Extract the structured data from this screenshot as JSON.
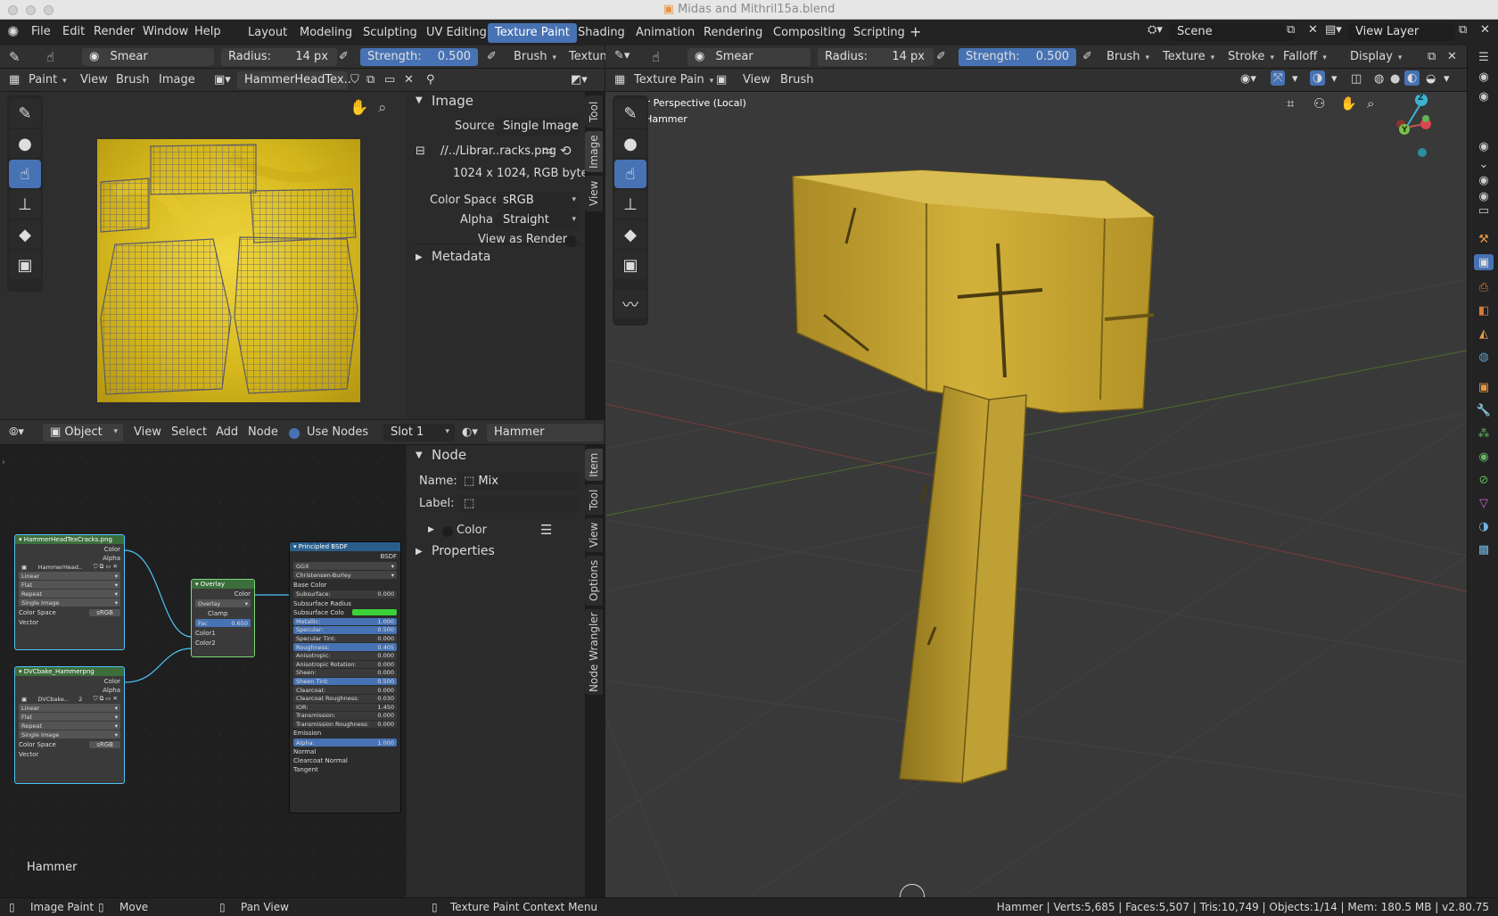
{
  "window": {
    "title": "Midas and Mithril15a.blend"
  },
  "menu": {
    "items": [
      "File",
      "Edit",
      "Render",
      "Window",
      "Help"
    ]
  },
  "workspaces": [
    "Layout",
    "Modeling",
    "Sculpting",
    "UV Editing",
    "Texture Paint",
    "Shading",
    "Animation",
    "Rendering",
    "Compositing",
    "Scripting"
  ],
  "workspace_active": "Texture Paint",
  "scene": {
    "label": "Scene",
    "view_layer": "View Layer"
  },
  "image_editor": {
    "tool_header": {
      "brush": "Smear",
      "radius_label": "Radius:",
      "radius_value": "14 px",
      "strength_label": "Strength:",
      "strength_value": "0.500",
      "brush_menu": "Brush",
      "texture_menu": "Textun"
    },
    "header": {
      "mode": "Paint",
      "menus": [
        "View",
        "Brush",
        "Image"
      ],
      "image_name": "HammerHeadTex.."
    },
    "image_panel": {
      "title": "Image",
      "source_label": "Source",
      "source_value": "Single Image",
      "filepath": "//../Librar..racks.png",
      "info": "1024 x 1024,  RGB byte",
      "colorspace_label": "Color Space",
      "colorspace_value": "sRGB",
      "alpha_label": "Alpha",
      "alpha_value": "Straight",
      "view_as_render": "View as Render",
      "metadata": "Metadata"
    },
    "tabs": [
      "Tool",
      "Image",
      "View"
    ]
  },
  "node_editor": {
    "header": {
      "type": "Object",
      "menus": [
        "View",
        "Select",
        "Add",
        "Node"
      ],
      "use_nodes": "Use Nodes",
      "slot": "Slot 1",
      "material": "Hammer"
    },
    "node_panel": {
      "title": "Node",
      "name_label": "Name:",
      "name_value": "Mix",
      "label_label": "Label:",
      "color": "Color",
      "properties": "Properties"
    },
    "tabs": [
      "Item",
      "Tool",
      "View",
      "Options",
      "Node Wrangler"
    ],
    "footer_label": "Hammer",
    "nodes": {
      "tex1": {
        "title": "HammerHeadTexCracks.png",
        "out1": "Color",
        "out2": "Alpha",
        "img": "HammerHead..",
        "interp": "Linear",
        "proj": "Flat",
        "ext": "Repeat",
        "src": "Single Image",
        "cs_label": "Color Space",
        "cs": "sRGB",
        "vec": "Vector"
      },
      "tex2": {
        "title": "DVCbake_Hammerpng",
        "out1": "Color",
        "out2": "Alpha",
        "img": "DVCbake..",
        "users": "2",
        "interp": "Linear",
        "proj": "Flat",
        "ext": "Repeat",
        "src": "Single Image",
        "cs_label": "Color Space",
        "cs": "sRGB",
        "vec": "Vector"
      },
      "mix": {
        "title": "Overlay",
        "out": "Color",
        "blend": "Overlay",
        "clamp": "Clamp",
        "fac_label": "Fac",
        "fac": "0.650",
        "c1": "Color1",
        "c2": "Color2"
      },
      "bsdf": {
        "title": "Principled BSDF",
        "out": "BSDF",
        "dist": "GGX",
        "sss_method": "Christensen-Burley",
        "base_color": "Base Color",
        "rows": [
          {
            "label": "Subsurface:",
            "value": "0.000"
          },
          {
            "label": "Subsurface Radius",
            "value": ""
          },
          {
            "label": "Subsurface Colo",
            "value": ""
          },
          {
            "label": "Metallic:",
            "value": "1.000"
          },
          {
            "label": "Specular:",
            "value": "0.500"
          },
          {
            "label": "Specular Tint:",
            "value": "0.000"
          },
          {
            "label": "Roughness:",
            "value": "0.405"
          },
          {
            "label": "Anisotropic:",
            "value": "0.000"
          },
          {
            "label": "Anisotropic Rotation:",
            "value": "0.000"
          },
          {
            "label": "Sheen:",
            "value": "0.000"
          },
          {
            "label": "Sheen Tint:",
            "value": "0.500"
          },
          {
            "label": "Clearcoat:",
            "value": "0.000"
          },
          {
            "label": "Clearcoat Roughness:",
            "value": "0.030"
          },
          {
            "label": "IOR:",
            "value": "1.450"
          },
          {
            "label": "Transmission:",
            "value": "0.000"
          },
          {
            "label": "Transmission Roughness:",
            "value": "0.000"
          },
          {
            "label": "Emission",
            "value": ""
          },
          {
            "label": "Alpha:",
            "value": "1.000"
          },
          {
            "label": "Normal",
            "value": ""
          },
          {
            "label": "Clearcoat Normal",
            "value": ""
          },
          {
            "label": "Tangent",
            "value": ""
          }
        ]
      }
    }
  },
  "viewport": {
    "tool_header": {
      "brush": "Smear",
      "radius_label": "Radius:",
      "radius_value": "14 px",
      "strength_label": "Strength:",
      "strength_value": "0.500",
      "menus": [
        "Brush",
        "Texture",
        "Stroke",
        "Falloff",
        "Display"
      ]
    },
    "header": {
      "mode": "Texture Pain",
      "menus": [
        "View",
        "Brush"
      ]
    },
    "overlay_text": {
      "line1": "User Perspective (Local)",
      "line2": "(1) Hammer"
    },
    "gizmo": {
      "z": "Z",
      "y": "Y"
    }
  },
  "statusbar": {
    "left": [
      {
        "icon": "mouse-left-icon",
        "label": "Image Paint"
      },
      {
        "icon": "mouse-middle-icon",
        "label": "Move"
      },
      {
        "icon": "mouse-middle-icon",
        "label": "Pan View"
      },
      {
        "icon": "mouse-right-icon",
        "label": "Texture Paint Context Menu"
      }
    ],
    "stats": "Hammer | Verts:5,685 | Faces:5,507 | Tris:10,749 | Objects:1/14 | Mem: 180.5 MB | v2.80.75"
  },
  "colors": {
    "accent": "#4772b3",
    "header": "#303030",
    "panel": "#2b2b2b",
    "viewport": "#393939",
    "texture_yellow": "#d9b81a",
    "hammer_gold": "#c8a733"
  }
}
